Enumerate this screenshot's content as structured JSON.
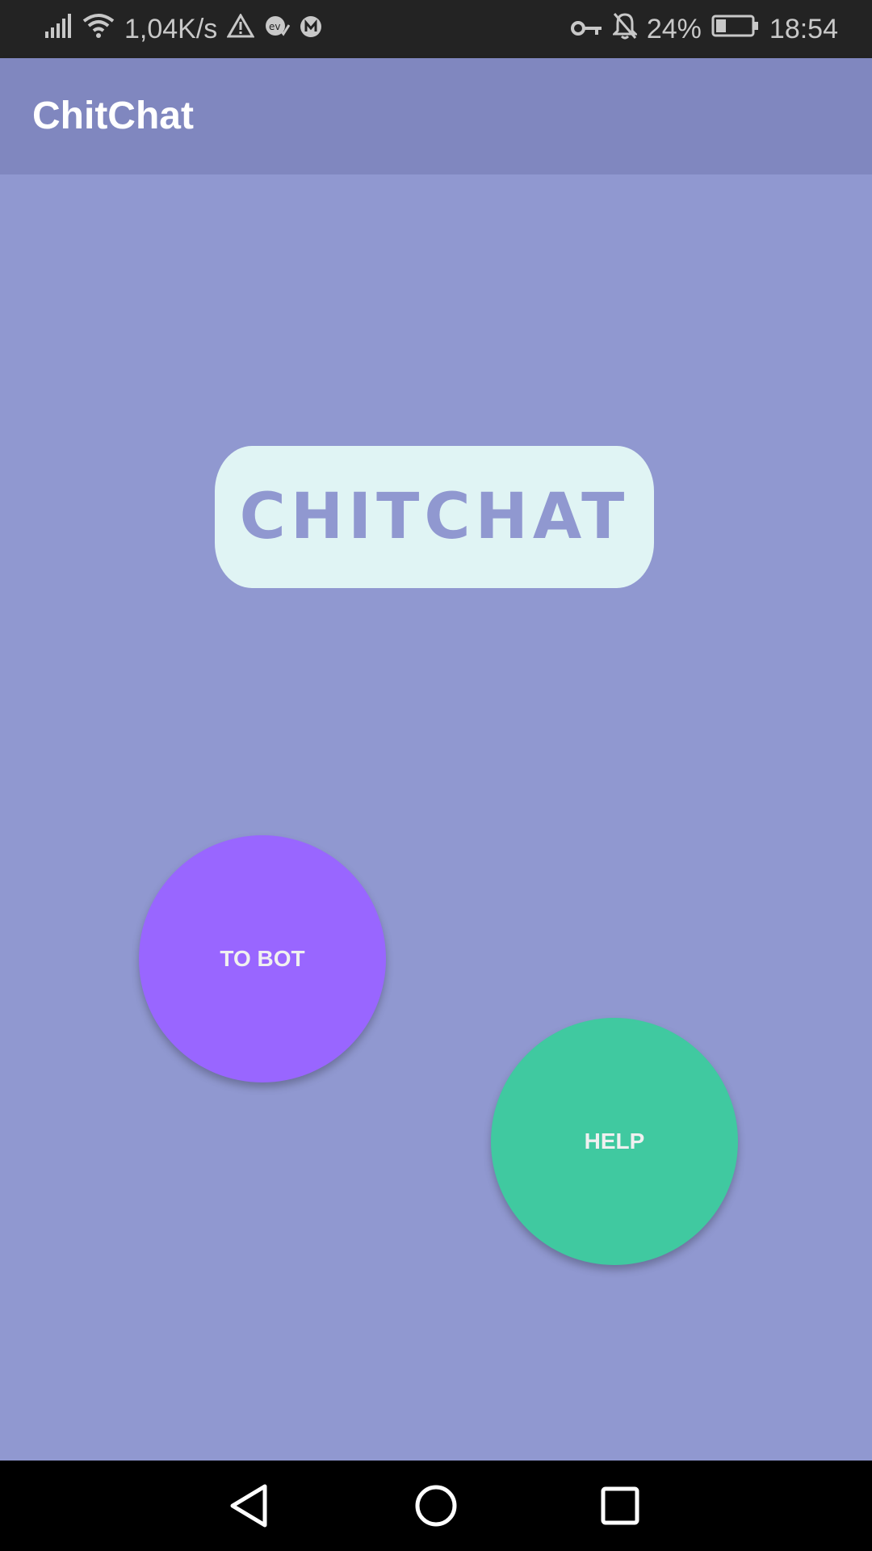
{
  "status_bar": {
    "speed": "1,04K/s",
    "battery": "24%",
    "time": "18:54",
    "icons_left": [
      "signal-icon",
      "wifi-icon",
      "warning-icon",
      "vpn-app-icon",
      "m-app-icon"
    ],
    "icons_right": [
      "key-icon",
      "notifications-off-icon",
      "battery-icon"
    ]
  },
  "app_bar": {
    "title": "ChitChat"
  },
  "logo": {
    "text": "CHITCHAT"
  },
  "buttons": {
    "to_bot": "TO BOT",
    "help": "HELP"
  },
  "colors": {
    "app_bar": "#8087bf",
    "background": "#9098d0",
    "logo_bg": "#e0f4f4",
    "to_bot": "#9966ff",
    "help": "#40c9a0"
  },
  "nav_bar": {
    "icons": [
      "back-icon",
      "home-icon",
      "recents-icon"
    ]
  }
}
